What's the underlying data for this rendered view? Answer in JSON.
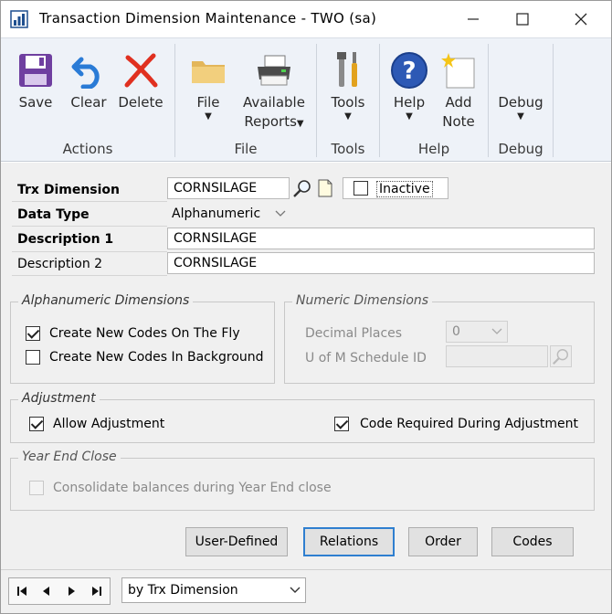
{
  "window": {
    "title": "Transaction Dimension Maintenance  -  TWO (sa)",
    "minimize_icon": "minimize-icon",
    "maximize_icon": "maximize-icon",
    "close_icon": "close-icon"
  },
  "ribbon": {
    "groups": [
      {
        "label": "Actions",
        "buttons": [
          {
            "label": "Save",
            "icon": "floppy-disk-icon"
          },
          {
            "label": "Clear",
            "icon": "undo-arrow-icon"
          },
          {
            "label": "Delete",
            "icon": "red-x-icon"
          }
        ]
      },
      {
        "label": "File",
        "buttons": [
          {
            "label": "File",
            "icon": "folder-icon",
            "dropdown": true
          },
          {
            "label": "Available",
            "label2": "Reports",
            "icon": "printer-icon",
            "dropdown": true
          }
        ]
      },
      {
        "label": "Tools",
        "buttons": [
          {
            "label": "Tools",
            "icon": "tools-icon",
            "dropdown": true
          }
        ]
      },
      {
        "label": "Help",
        "buttons": [
          {
            "label": "Help",
            "icon": "help-icon",
            "dropdown": true
          },
          {
            "label": "Add",
            "label2": "Note",
            "icon": "note-icon"
          }
        ]
      },
      {
        "label": "Debug",
        "buttons": [
          {
            "label": "Debug",
            "dropdown": true
          }
        ]
      }
    ]
  },
  "form": {
    "trx_dimension": {
      "label": "Trx Dimension",
      "value": "CORNSILAGE"
    },
    "inactive": {
      "label": "Inactive",
      "checked": false
    },
    "data_type": {
      "label": "Data Type",
      "value": "Alphanumeric"
    },
    "description1": {
      "label": "Description 1",
      "value": "CORNSILAGE"
    },
    "description2": {
      "label": "Description 2",
      "value": "CORNSILAGE"
    },
    "alphanumeric": {
      "title": "Alphanumeric Dimensions",
      "create_on_fly": {
        "label": "Create New Codes On The Fly",
        "checked": true
      },
      "create_background": {
        "label": "Create New Codes In Background",
        "checked": false
      }
    },
    "numeric": {
      "title": "Numeric Dimensions",
      "decimal_places": {
        "label": "Decimal Places",
        "value": "0"
      },
      "uofm_schedule": {
        "label": "U of M Schedule ID",
        "value": ""
      }
    },
    "adjustment": {
      "title": "Adjustment",
      "allow": {
        "label": "Allow Adjustment",
        "checked": true
      },
      "code_required": {
        "label": "Code Required During Adjustment",
        "checked": true
      }
    },
    "year_end": {
      "title": "Year End Close",
      "consolidate": {
        "label": "Consolidate balances during Year End close",
        "checked": false
      }
    },
    "buttons": {
      "user_defined": "User-Defined",
      "relations": "Relations",
      "order": "Order",
      "codes": "Codes"
    }
  },
  "navbar": {
    "sort_by": "by Trx Dimension"
  }
}
